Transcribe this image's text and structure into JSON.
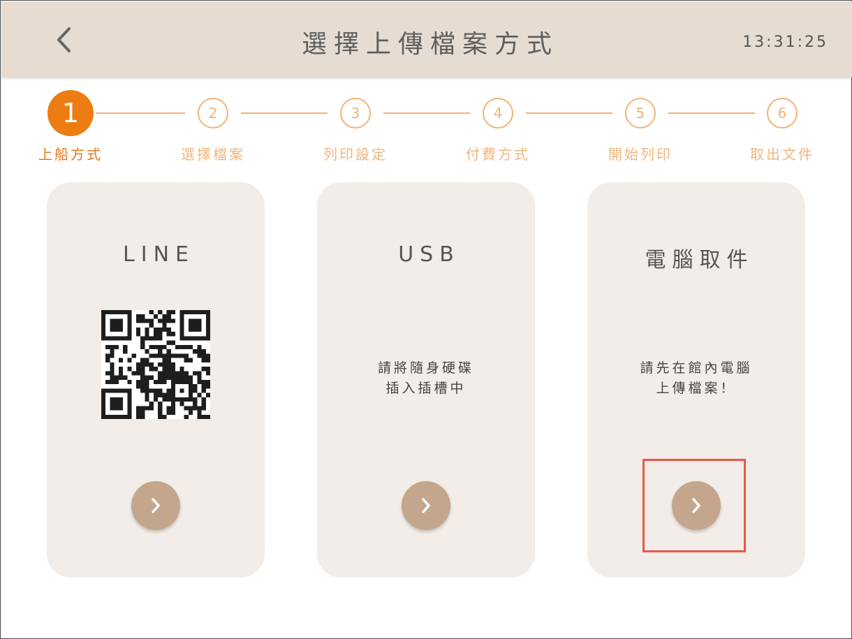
{
  "header": {
    "title": "選擇上傳檔案方式",
    "time": "13:31:25",
    "back_icon": "chevron-left-icon"
  },
  "colors": {
    "header_bg": "#e6dcd2",
    "accent": "#ed7d12",
    "step_pending": "#efb377",
    "card_bg": "#f2ede8",
    "button": "#c3a68c",
    "highlight": "#e8574a"
  },
  "steps": [
    {
      "number": "1",
      "label": "上船方式",
      "state": "active"
    },
    {
      "number": "2",
      "label": "選擇檔案",
      "state": "pending"
    },
    {
      "number": "3",
      "label": "列印設定",
      "state": "pending"
    },
    {
      "number": "4",
      "label": "付費方式",
      "state": "pending"
    },
    {
      "number": "5",
      "label": "開始列印",
      "state": "pending"
    },
    {
      "number": "6",
      "label": "取出文件",
      "state": "pending"
    }
  ],
  "cards": [
    {
      "title": "LINE",
      "content": "qr-code",
      "button_icon": "chevron-right-icon"
    },
    {
      "title": "USB",
      "description": [
        "請將隨身硬碟",
        "插入插槽中"
      ],
      "button_icon": "chevron-right-icon"
    },
    {
      "title": "電腦取件",
      "description": [
        "請先在館內電腦",
        "上傳檔案！"
      ],
      "button_icon": "chevron-right-icon"
    }
  ]
}
